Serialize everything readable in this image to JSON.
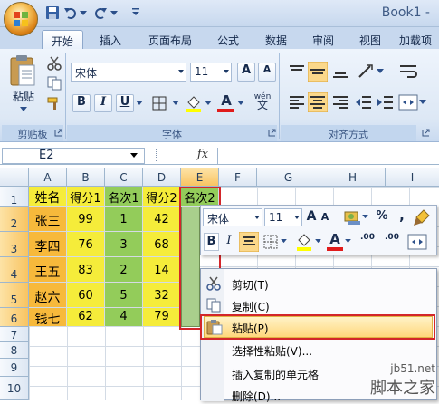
{
  "window": {
    "title": "Book1 -"
  },
  "tabs": [
    {
      "label": "开始"
    },
    {
      "label": "插入"
    },
    {
      "label": "页面布局"
    },
    {
      "label": "公式"
    },
    {
      "label": "数据"
    },
    {
      "label": "审阅"
    },
    {
      "label": "视图"
    },
    {
      "label": "加载项"
    }
  ],
  "ribbon": {
    "paste_label": "粘贴",
    "clipboard_group": "剪贴板",
    "font_group": "字体",
    "align_group": "对齐方式",
    "font_name": "宋体",
    "font_size": "11",
    "bold": "B",
    "italic": "I",
    "underline": "U",
    "wen_label": "wén",
    "font_color_glyph": "A"
  },
  "formula_bar": {
    "name_box": "E2",
    "fx": "fx"
  },
  "grid": {
    "columns": [
      "A",
      "B",
      "C",
      "D",
      "E",
      "F",
      "G",
      "H",
      "I"
    ],
    "rows": [
      "1",
      "2",
      "3",
      "4",
      "5",
      "6",
      "7",
      "8",
      "9",
      "10"
    ],
    "header_row": [
      "姓名",
      "得分1",
      "名次1",
      "得分2",
      "名次2"
    ],
    "data": [
      [
        "张三",
        "99",
        "1",
        "42"
      ],
      [
        "李四",
        "76",
        "3",
        "68"
      ],
      [
        "王五",
        "83",
        "2",
        "14"
      ],
      [
        "赵六",
        "60",
        "5",
        "32"
      ],
      [
        "钱七",
        "62",
        "4",
        "79"
      ]
    ]
  },
  "mini_toolbar": {
    "font_name": "宋体",
    "font_size": "11",
    "grow": "A",
    "shrink": "A",
    "percent": "%",
    "comma": ",",
    "bold": "B",
    "italic": "I",
    "font_color": "A",
    "inc_decimal": ".00",
    "dec_decimal": ".00"
  },
  "context_menu": {
    "items": [
      {
        "label": "剪切(T)"
      },
      {
        "label": "复制(C)"
      },
      {
        "label": "粘贴(P)"
      },
      {
        "label": "选择性粘贴(V)..."
      },
      {
        "label": "插入复制的单元格"
      },
      {
        "label": "删除(D)..."
      }
    ]
  },
  "watermark": {
    "line1": "jb51.net",
    "line2": "脚本之家"
  },
  "colors": {
    "header_fill": "#f5ec3a",
    "name_fill": "#f7b93b",
    "rank_fill": "#93cc5a",
    "score_fill": "#f5ec3a",
    "highlight": "#d3262a"
  }
}
